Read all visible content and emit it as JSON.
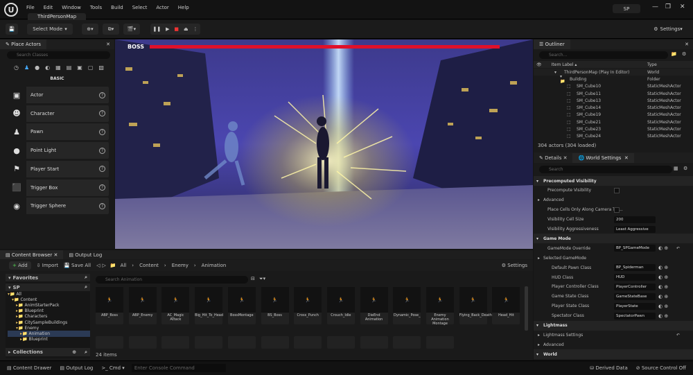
{
  "app": {
    "map_tab": "ThirdPersonMap",
    "profile": "SP"
  },
  "menu": [
    "File",
    "Edit",
    "Window",
    "Tools",
    "Build",
    "Select",
    "Actor",
    "Help"
  ],
  "toolbar": {
    "select_mode": "Select Mode",
    "settings": "Settings"
  },
  "place_actors": {
    "tab": "Place Actors",
    "search_placeholder": "Search Classes",
    "category": "BASIC",
    "items": [
      {
        "label": "Actor",
        "icon": "cube-icon"
      },
      {
        "label": "Character",
        "icon": "character-icon"
      },
      {
        "label": "Pawn",
        "icon": "pawn-icon"
      },
      {
        "label": "Point Light",
        "icon": "light-bulb-icon"
      },
      {
        "label": "Player Start",
        "icon": "flag-icon"
      },
      {
        "label": "Trigger Box",
        "icon": "trigger-box-icon"
      },
      {
        "label": "Trigger Sphere",
        "icon": "trigger-sphere-icon"
      }
    ]
  },
  "viewport": {
    "boss_label": "BOSS",
    "boss_health": 1.0,
    "health_color": "#e0102a"
  },
  "outliner": {
    "tab": "Outliner",
    "search_placeholder": "Search...",
    "col_label": "Item Label",
    "col_type": "Type",
    "rows": [
      {
        "label": "ThirdPersonMap (Play In Editor)",
        "type": "World"
      },
      {
        "label": "Building",
        "type": "Folder"
      },
      {
        "label": "SM_Cube10",
        "type": "StaticMeshActor"
      },
      {
        "label": "SM_Cube11",
        "type": "StaticMeshActor"
      },
      {
        "label": "SM_Cube13",
        "type": "StaticMeshActor"
      },
      {
        "label": "SM_Cube14",
        "type": "StaticMeshActor"
      },
      {
        "label": "SM_Cube19",
        "type": "StaticMeshActor"
      },
      {
        "label": "SM_Cube21",
        "type": "StaticMeshActor"
      },
      {
        "label": "SM_Cube23",
        "type": "StaticMeshActor"
      },
      {
        "label": "SM_Cube24",
        "type": "StaticMeshActor"
      }
    ],
    "count": "304 actors (304 loaded)"
  },
  "details": {
    "tab_details": "Details",
    "tab_world": "World Settings",
    "search_placeholder": "Search",
    "rows": [
      {
        "label": "Precomputed Visibility",
        "cat": true
      },
      {
        "label": "Precompute Visibility",
        "check": true
      },
      {
        "label": "Advanced",
        "sub": true
      },
      {
        "label": "Place Cells Only Along Camera Tra...",
        "check": true
      },
      {
        "label": "Visibility Cell Size",
        "value": "200"
      },
      {
        "label": "Visibility Aggressiveness",
        "value": "Least Aggressive"
      },
      {
        "label": "Game Mode",
        "cat": true
      },
      {
        "label": "GameMode Override",
        "value": "BP_SPGameMode"
      },
      {
        "label": "Selected GameMode",
        "sub": true
      },
      {
        "label": "Default Pawn Class",
        "value": "BP_Spiderman"
      },
      {
        "label": "HUD Class",
        "value": "HUD"
      },
      {
        "label": "Player Controller Class",
        "value": "PlayerController"
      },
      {
        "label": "Game State Class",
        "value": "GameStateBase"
      },
      {
        "label": "Player State Class",
        "value": "PlayerState"
      },
      {
        "label": "Spectator Class",
        "value": "SpectatorPawn"
      },
      {
        "label": "Lightmass",
        "cat": true
      },
      {
        "label": "Lightmass Settings",
        "sub": true
      },
      {
        "label": "Advanced",
        "sub": true
      },
      {
        "label": "World",
        "cat": true
      }
    ]
  },
  "content_browser": {
    "tab": "Content Browser",
    "tab_output": "Output Log",
    "add": "Add",
    "import": "Import",
    "save_all": "Save All",
    "settings": "Settings",
    "path": [
      "All",
      "Content",
      "Enemy",
      "Animation"
    ],
    "favorites": "Favorites",
    "sp": "SP",
    "tree": [
      "All",
      "Content",
      "AnimStarterPack",
      "Blueprint",
      "Characters",
      "CitySampleBuildings",
      "Enemy",
      "Animation",
      "Blueprint"
    ],
    "collections": "Collections",
    "search_placeholder": "Search Animation",
    "item_count": "24 items",
    "assets": [
      "ABP_Boss",
      "ABP_Enemy",
      "AC_Magic Attack",
      "Big_Hit_To_Head",
      "BossMontage",
      "BS_Boss",
      "Cross_Punch",
      "Crouch_Idle",
      "DieEnd Animation",
      "Dynamic_Pose_",
      "Enemy Animation Montage",
      "Flying_Back_Death",
      "Head_Hit"
    ]
  },
  "status": {
    "content_drawer": "Content Drawer",
    "output_log": "Output Log",
    "cmd": "Cmd",
    "console_placeholder": "Enter Console Command",
    "derived_data": "Derived Data",
    "source_control": "Source Control Off"
  }
}
